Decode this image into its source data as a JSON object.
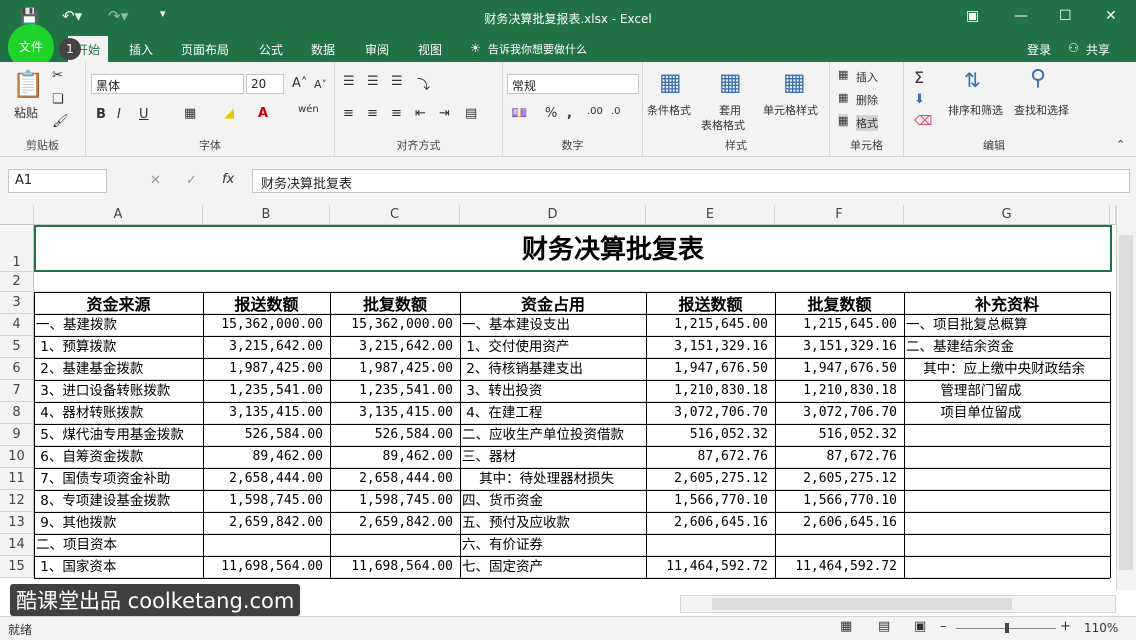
{
  "window": {
    "title": "财务决算批复报表.xlsx - Excel"
  },
  "tabs": [
    "开始",
    "插入",
    "页面布局",
    "公式",
    "数据",
    "审阅",
    "视图"
  ],
  "file_tab": "文件",
  "badge": "1",
  "tell_me": "告诉我你想要做什么",
  "login": "登录",
  "share": "共享",
  "ribbon": {
    "paste": "粘贴",
    "clipboard": "剪贴板",
    "font_name": "黑体",
    "font_size": "20",
    "font_group": "字体",
    "align_group": "对齐方式",
    "number_format": "常规",
    "number_group": "数字",
    "cond_format": "条件格式",
    "table_format_1": "套用",
    "table_format_2": "表格格式",
    "cell_style": "单元格样式",
    "style_group": "样式",
    "insert": "插入",
    "delete": "删除",
    "format": "格式",
    "cells_group": "单元格",
    "sort_filter": "排序和筛选",
    "find_select": "查找和选择",
    "edit_group": "编辑",
    "bold": "B",
    "italic": "I",
    "underline": "U",
    "wen": "wén"
  },
  "formula_bar": {
    "name_box": "A1",
    "fx": "fx",
    "content": "财务决算批复表"
  },
  "columns": [
    "A",
    "B",
    "C",
    "D",
    "E",
    "F",
    "G"
  ],
  "rows": [
    "1",
    "2",
    "3",
    "4",
    "5",
    "6",
    "7",
    "8",
    "9",
    "10",
    "11",
    "12",
    "13",
    "14",
    "15"
  ],
  "sheet_title": "财务决算批复表",
  "headers": [
    "资金来源",
    "报送数额",
    "批复数额",
    "资金占用",
    "报送数额",
    "批复数额",
    "补充资料"
  ],
  "data": [
    [
      "一、基建拨款",
      "15,362,000.00",
      "15,362,000.00",
      "一、基本建设支出",
      "1,215,645.00",
      "1,215,645.00",
      "一、项目批复总概算"
    ],
    [
      " 1、预算拨款",
      "3,215,642.00",
      "3,215,642.00",
      " 1、交付使用资产",
      "3,151,329.16",
      "3,151,329.16",
      "二、基建结余资金"
    ],
    [
      " 2、基建基金拨款",
      "1,987,425.00",
      "1,987,425.00",
      " 2、待核销基建支出",
      "1,947,676.50",
      "1,947,676.50",
      "    其中：应上缴中央财政结余"
    ],
    [
      " 3、进口设备转账拨款",
      "1,235,541.00",
      "1,235,541.00",
      " 3、转出投资",
      "1,210,830.18",
      "1,210,830.18",
      "        管理部门留成"
    ],
    [
      " 4、器材转账拨款",
      "3,135,415.00",
      "3,135,415.00",
      " 4、在建工程",
      "3,072,706.70",
      "3,072,706.70",
      "        项目单位留成"
    ],
    [
      " 5、煤代油专用基金拨款",
      "526,584.00",
      "526,584.00",
      "二、应收生产单位投资借款",
      "516,052.32",
      "516,052.32",
      ""
    ],
    [
      " 6、自筹资金拨款",
      "89,462.00",
      "89,462.00",
      "三、器材",
      "87,672.76",
      "87,672.76",
      ""
    ],
    [
      " 7、国债专项资金补助",
      "2,658,444.00",
      "2,658,444.00",
      "    其中：待处理器材损失",
      "2,605,275.12",
      "2,605,275.12",
      ""
    ],
    [
      " 8、专项建设基金拨款",
      "1,598,745.00",
      "1,598,745.00",
      "四、货币资金",
      "1,566,770.10",
      "1,566,770.10",
      ""
    ],
    [
      " 9、其他拨款",
      "2,659,842.00",
      "2,659,842.00",
      "五、预付及应收款",
      "2,606,645.16",
      "2,606,645.16",
      ""
    ],
    [
      "二、项目资本",
      "",
      "",
      "六、有价证券",
      "",
      "",
      ""
    ],
    [
      " 1、国家资本",
      "11,698,564.00",
      "11,698,564.00",
      "七、固定资产",
      "11,464,592.72",
      "11,464,592.72",
      ""
    ]
  ],
  "status": {
    "ready": "就绪",
    "zoom": "110%"
  },
  "watermark": "酷课堂出品 coolketang.com"
}
